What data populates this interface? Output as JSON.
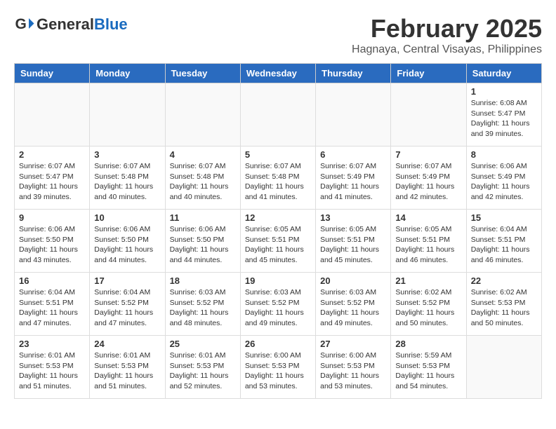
{
  "header": {
    "logo_general": "General",
    "logo_blue": "Blue",
    "month_title": "February 2025",
    "location": "Hagnaya, Central Visayas, Philippines"
  },
  "weekdays": [
    "Sunday",
    "Monday",
    "Tuesday",
    "Wednesday",
    "Thursday",
    "Friday",
    "Saturday"
  ],
  "weeks": [
    [
      {
        "day": "",
        "info": ""
      },
      {
        "day": "",
        "info": ""
      },
      {
        "day": "",
        "info": ""
      },
      {
        "day": "",
        "info": ""
      },
      {
        "day": "",
        "info": ""
      },
      {
        "day": "",
        "info": ""
      },
      {
        "day": "1",
        "info": "Sunrise: 6:08 AM\nSunset: 5:47 PM\nDaylight: 11 hours\nand 39 minutes."
      }
    ],
    [
      {
        "day": "2",
        "info": "Sunrise: 6:07 AM\nSunset: 5:47 PM\nDaylight: 11 hours\nand 39 minutes."
      },
      {
        "day": "3",
        "info": "Sunrise: 6:07 AM\nSunset: 5:48 PM\nDaylight: 11 hours\nand 40 minutes."
      },
      {
        "day": "4",
        "info": "Sunrise: 6:07 AM\nSunset: 5:48 PM\nDaylight: 11 hours\nand 40 minutes."
      },
      {
        "day": "5",
        "info": "Sunrise: 6:07 AM\nSunset: 5:48 PM\nDaylight: 11 hours\nand 41 minutes."
      },
      {
        "day": "6",
        "info": "Sunrise: 6:07 AM\nSunset: 5:49 PM\nDaylight: 11 hours\nand 41 minutes."
      },
      {
        "day": "7",
        "info": "Sunrise: 6:07 AM\nSunset: 5:49 PM\nDaylight: 11 hours\nand 42 minutes."
      },
      {
        "day": "8",
        "info": "Sunrise: 6:06 AM\nSunset: 5:49 PM\nDaylight: 11 hours\nand 42 minutes."
      }
    ],
    [
      {
        "day": "9",
        "info": "Sunrise: 6:06 AM\nSunset: 5:50 PM\nDaylight: 11 hours\nand 43 minutes."
      },
      {
        "day": "10",
        "info": "Sunrise: 6:06 AM\nSunset: 5:50 PM\nDaylight: 11 hours\nand 44 minutes."
      },
      {
        "day": "11",
        "info": "Sunrise: 6:06 AM\nSunset: 5:50 PM\nDaylight: 11 hours\nand 44 minutes."
      },
      {
        "day": "12",
        "info": "Sunrise: 6:05 AM\nSunset: 5:51 PM\nDaylight: 11 hours\nand 45 minutes."
      },
      {
        "day": "13",
        "info": "Sunrise: 6:05 AM\nSunset: 5:51 PM\nDaylight: 11 hours\nand 45 minutes."
      },
      {
        "day": "14",
        "info": "Sunrise: 6:05 AM\nSunset: 5:51 PM\nDaylight: 11 hours\nand 46 minutes."
      },
      {
        "day": "15",
        "info": "Sunrise: 6:04 AM\nSunset: 5:51 PM\nDaylight: 11 hours\nand 46 minutes."
      }
    ],
    [
      {
        "day": "16",
        "info": "Sunrise: 6:04 AM\nSunset: 5:51 PM\nDaylight: 11 hours\nand 47 minutes."
      },
      {
        "day": "17",
        "info": "Sunrise: 6:04 AM\nSunset: 5:52 PM\nDaylight: 11 hours\nand 47 minutes."
      },
      {
        "day": "18",
        "info": "Sunrise: 6:03 AM\nSunset: 5:52 PM\nDaylight: 11 hours\nand 48 minutes."
      },
      {
        "day": "19",
        "info": "Sunrise: 6:03 AM\nSunset: 5:52 PM\nDaylight: 11 hours\nand 49 minutes."
      },
      {
        "day": "20",
        "info": "Sunrise: 6:03 AM\nSunset: 5:52 PM\nDaylight: 11 hours\nand 49 minutes."
      },
      {
        "day": "21",
        "info": "Sunrise: 6:02 AM\nSunset: 5:52 PM\nDaylight: 11 hours\nand 50 minutes."
      },
      {
        "day": "22",
        "info": "Sunrise: 6:02 AM\nSunset: 5:53 PM\nDaylight: 11 hours\nand 50 minutes."
      }
    ],
    [
      {
        "day": "23",
        "info": "Sunrise: 6:01 AM\nSunset: 5:53 PM\nDaylight: 11 hours\nand 51 minutes."
      },
      {
        "day": "24",
        "info": "Sunrise: 6:01 AM\nSunset: 5:53 PM\nDaylight: 11 hours\nand 51 minutes."
      },
      {
        "day": "25",
        "info": "Sunrise: 6:01 AM\nSunset: 5:53 PM\nDaylight: 11 hours\nand 52 minutes."
      },
      {
        "day": "26",
        "info": "Sunrise: 6:00 AM\nSunset: 5:53 PM\nDaylight: 11 hours\nand 53 minutes."
      },
      {
        "day": "27",
        "info": "Sunrise: 6:00 AM\nSunset: 5:53 PM\nDaylight: 11 hours\nand 53 minutes."
      },
      {
        "day": "28",
        "info": "Sunrise: 5:59 AM\nSunset: 5:53 PM\nDaylight: 11 hours\nand 54 minutes."
      },
      {
        "day": "",
        "info": ""
      }
    ]
  ]
}
